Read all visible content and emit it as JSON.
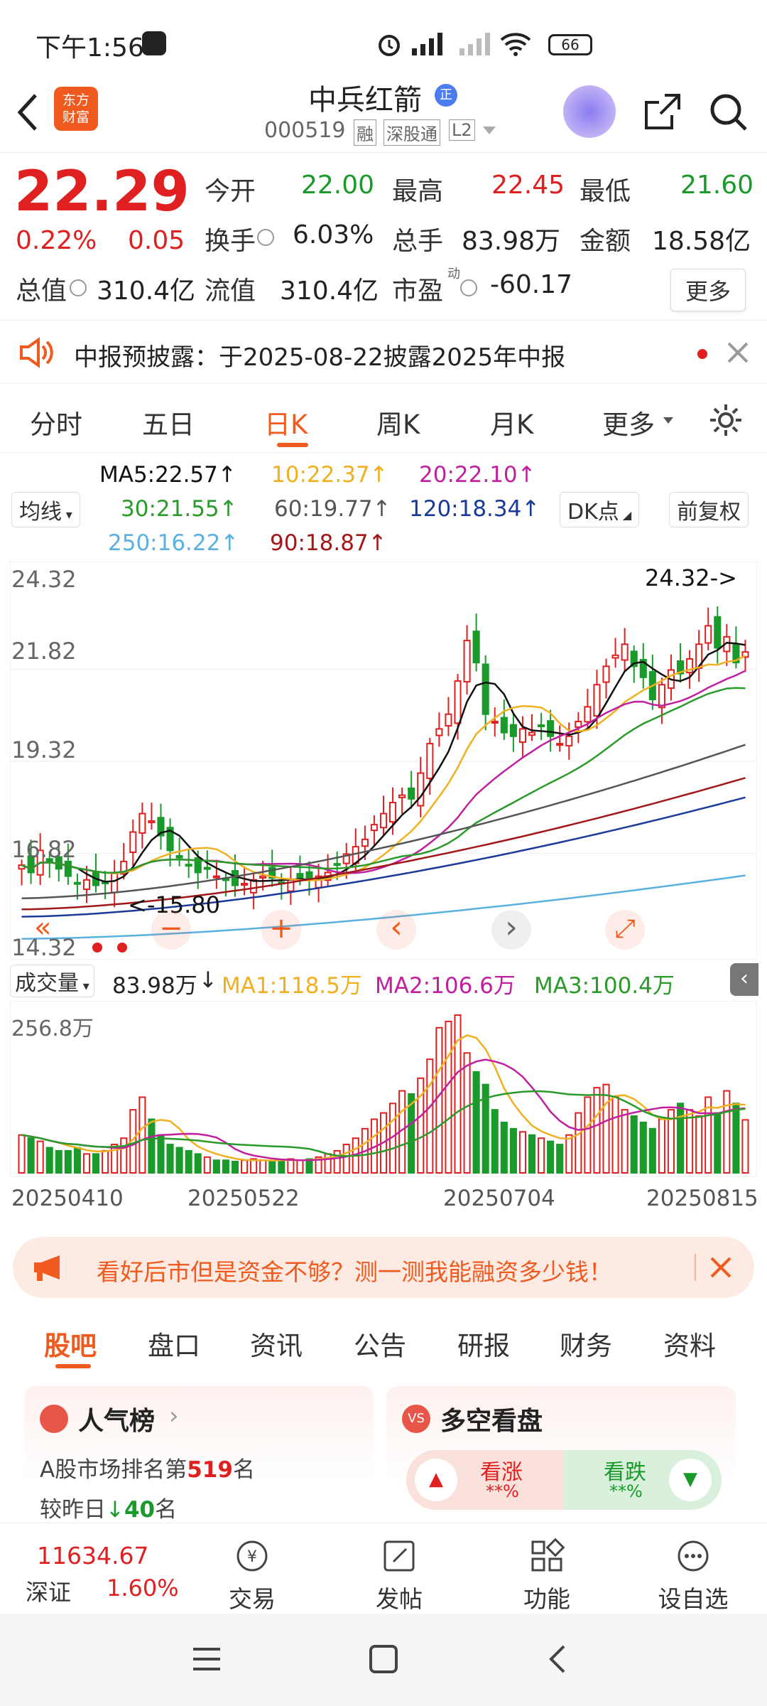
{
  "status_bar": {
    "time": "下午1:56",
    "battery": "66"
  },
  "header": {
    "title": "中兵红箭",
    "code": "000519",
    "tags": [
      "融",
      "深股通",
      "L2"
    ],
    "logo_text_top": "东方",
    "logo_text_bottom": "财富",
    "zheng_badge": "正"
  },
  "quote": {
    "price": "22.29",
    "change_pct": "0.22%",
    "change": "0.05",
    "open_label": "今开",
    "open": "22.00",
    "high_label": "最高",
    "high": "22.45",
    "low_label": "最低",
    "low": "21.60",
    "turnover_label": "换手",
    "turnover": "6.03%",
    "volume_label": "总手",
    "volume": "83.98万",
    "amount_label": "金额",
    "amount": "18.58亿",
    "mktcap_label": "总值",
    "mktcap": "310.4亿",
    "float_label": "流值",
    "float_cap": "310.4亿",
    "pe_label": "市盈",
    "pe_sup": "动",
    "pe": "-60.17",
    "more_button": "更多"
  },
  "notice": {
    "text": "中报预披露：于2025-08-22披露2025年中报"
  },
  "period_tabs": [
    "分时",
    "五日",
    "日K",
    "周K",
    "月K",
    "更多"
  ],
  "active_period": "日K",
  "ma_indicators": {
    "select_label": "均线",
    "ma5": "MA5:22.57↑",
    "ma10": "10:22.37↑",
    "ma20": "20:22.10↑",
    "ma30": "30:21.55↑",
    "ma60": "60:19.77↑",
    "ma120": "120:18.34↑",
    "ma250": "250:16.22↑",
    "ma90": "90:18.87↑",
    "dk_button": "DK点",
    "fq_button": "前复权"
  },
  "colors": {
    "up": "#e02020",
    "down": "#1a9a2a",
    "ma5": "#111111",
    "ma10": "#f0b020",
    "ma20": "#c020a0",
    "ma30": "#2a9a2a",
    "ma60": "#555555",
    "ma120": "#1a3a9a",
    "ma250": "#5ab0e0",
    "ma90": "#a01818",
    "accent": "#f05a1e"
  },
  "chart_data": {
    "type": "candlestick",
    "price_labels": [
      "24.32",
      "21.82",
      "19.32",
      "16.82",
      "14.32"
    ],
    "high_marker": "24.32->",
    "low_marker": "<-15.80",
    "ylim": [
      14.32,
      24.32
    ],
    "x_labels": [
      "20250410",
      "20250522",
      "20250704",
      "20250815"
    ],
    "closes": [
      16.5,
      16.3,
      16.9,
      16.6,
      16.4,
      16.2,
      16.0,
      16.1,
      15.95,
      16.0,
      16.3,
      16.6,
      17.4,
      17.9,
      17.7,
      17.3,
      16.9,
      16.7,
      16.5,
      16.3,
      16.4,
      16.2,
      16.1,
      15.95,
      16.0,
      16.1,
      16.2,
      16.15,
      16.0,
      16.1,
      16.15,
      16.1,
      16.2,
      16.3,
      16.5,
      16.8,
      17.0,
      17.2,
      17.6,
      17.9,
      18.2,
      18.4,
      18.3,
      19.0,
      19.8,
      20.2,
      20.6,
      21.5,
      22.6,
      22.0,
      20.6,
      20.4,
      20.1,
      20.0,
      20.2,
      20.1,
      20.3,
      20.0,
      19.8,
      20.0,
      20.4,
      20.8,
      21.4,
      21.9,
      22.2,
      22.5,
      21.9,
      21.6,
      21.0,
      21.4,
      21.8,
      21.7,
      22.1,
      22.5,
      23.0,
      22.4,
      22.7,
      22.0,
      22.29
    ],
    "volume": {
      "label": "成交量",
      "value": "83.98万",
      "ma1": "MA1:118.5万",
      "ma2": "MA2:106.6万",
      "ma3": "MA3:100.4万",
      "max_label": "256.8万",
      "bars": [
        60,
        55,
        50,
        40,
        35,
        35,
        40,
        30,
        30,
        35,
        45,
        55,
        100,
        120,
        85,
        60,
        45,
        40,
        35,
        30,
        25,
        20,
        20,
        18,
        20,
        22,
        20,
        18,
        20,
        22,
        20,
        22,
        25,
        30,
        35,
        45,
        55,
        70,
        85,
        95,
        110,
        130,
        125,
        150,
        180,
        230,
        240,
        250,
        190,
        160,
        140,
        100,
        80,
        70,
        65,
        60,
        55,
        50,
        45,
        60,
        95,
        120,
        135,
        140,
        120,
        100,
        90,
        80,
        70,
        85,
        100,
        110,
        100,
        90,
        120,
        95,
        130,
        110,
        83.98
      ],
      "up": [
        true,
        false,
        true,
        false,
        false,
        false,
        false,
        true,
        false,
        true,
        true,
        true,
        true,
        true,
        false,
        false,
        false,
        false,
        false,
        false,
        true,
        false,
        false,
        false,
        true,
        true,
        true,
        false,
        false,
        true,
        true,
        false,
        true,
        true,
        true,
        true,
        true,
        true,
        true,
        true,
        true,
        true,
        false,
        true,
        true,
        true,
        true,
        true,
        true,
        false,
        false,
        false,
        false,
        false,
        true,
        false,
        true,
        false,
        false,
        true,
        true,
        true,
        true,
        true,
        true,
        true,
        false,
        false,
        false,
        true,
        true,
        false,
        true,
        true,
        true,
        false,
        true,
        false,
        true
      ]
    }
  },
  "chart_controls": {
    "prev": "«",
    "minus": "−",
    "plus": "+",
    "left": "‹",
    "right": "›",
    "expand": "⤢"
  },
  "ad": {
    "text": "看好后市但是资金不够？测一测我能融资多少钱！"
  },
  "sub_tabs": [
    "股吧",
    "盘口",
    "资讯",
    "公告",
    "研报",
    "财务",
    "资料"
  ],
  "active_sub_tab": "股吧",
  "cards": {
    "popularity": {
      "title": "人气榜",
      "line1_pre": "A股市场排名第",
      "line1_num": "519",
      "line1_post": "名",
      "line2_pre": "较昨日",
      "line2_num": "40",
      "line2_post": "名"
    },
    "sentiment": {
      "title": "多空看盘",
      "up_label": "看涨",
      "up_value": "**%",
      "down_label": "看跌",
      "down_value": "**%"
    }
  },
  "bottom_nav": {
    "index_value": "11634.67",
    "index_name": "深证",
    "index_change": "1.60%",
    "items": [
      "交易",
      "发帖",
      "功能",
      "设自选"
    ]
  }
}
